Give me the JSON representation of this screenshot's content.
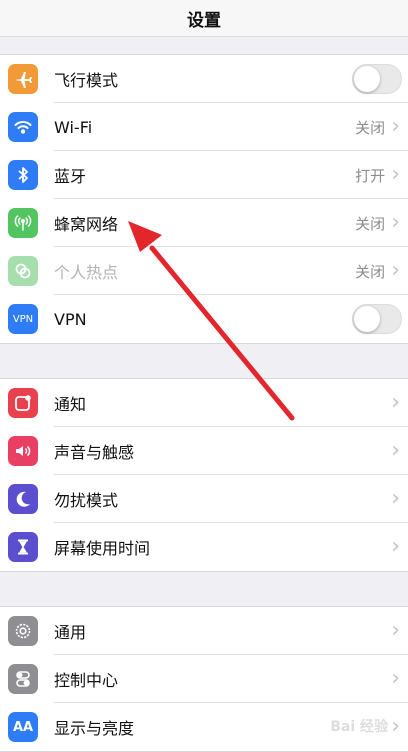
{
  "nav": {
    "title": "设置"
  },
  "group1": [
    {
      "name": "airplane",
      "label": "飞行模式",
      "color": "#f19a37",
      "icon": "airplane-icon"
    },
    {
      "name": "wifi",
      "label": "Wi-Fi",
      "value": "关闭",
      "color": "#2f7df6",
      "icon": "wifi-icon"
    },
    {
      "name": "bluetooth",
      "label": "蓝牙",
      "value": "打开",
      "color": "#2f7df6",
      "icon": "bluetooth-icon"
    },
    {
      "name": "cellular",
      "label": "蜂窝网络",
      "value": "关闭",
      "color": "#52c462",
      "icon": "antenna-icon"
    },
    {
      "name": "hotspot",
      "label": "个人热点",
      "value": "关闭",
      "color": "#a6dfad",
      "icon": "chain-link-icon"
    },
    {
      "name": "vpn",
      "label": "VPN",
      "color": "#2f7df6",
      "icon": "vpn-icon",
      "icon_text": "VPN"
    }
  ],
  "group2": [
    {
      "name": "notifications",
      "label": "通知",
      "color": "#e9404f",
      "icon": "notification-icon"
    },
    {
      "name": "sounds",
      "label": "声音与触感",
      "color": "#ea3f64",
      "icon": "speaker-icon"
    },
    {
      "name": "dnd",
      "label": "勿扰模式",
      "color": "#5b4fcf",
      "icon": "moon-icon"
    },
    {
      "name": "screentime",
      "label": "屏幕使用时间",
      "color": "#5b4fcf",
      "icon": "hourglass-icon"
    }
  ],
  "group3": [
    {
      "name": "general",
      "label": "通用",
      "color": "#8e8e93",
      "icon": "gear-icon"
    },
    {
      "name": "control-center",
      "label": "控制中心",
      "color": "#8e8e93",
      "icon": "switches-icon"
    },
    {
      "name": "display",
      "label": "显示与亮度",
      "color": "#2f7df6",
      "icon": "text-size-icon",
      "icon_text": "AA"
    }
  ],
  "states": {
    "airplane_on": false,
    "vpn_on": false
  },
  "annotation": {
    "color": "#e3262c"
  },
  "watermark": "Bai 经验"
}
